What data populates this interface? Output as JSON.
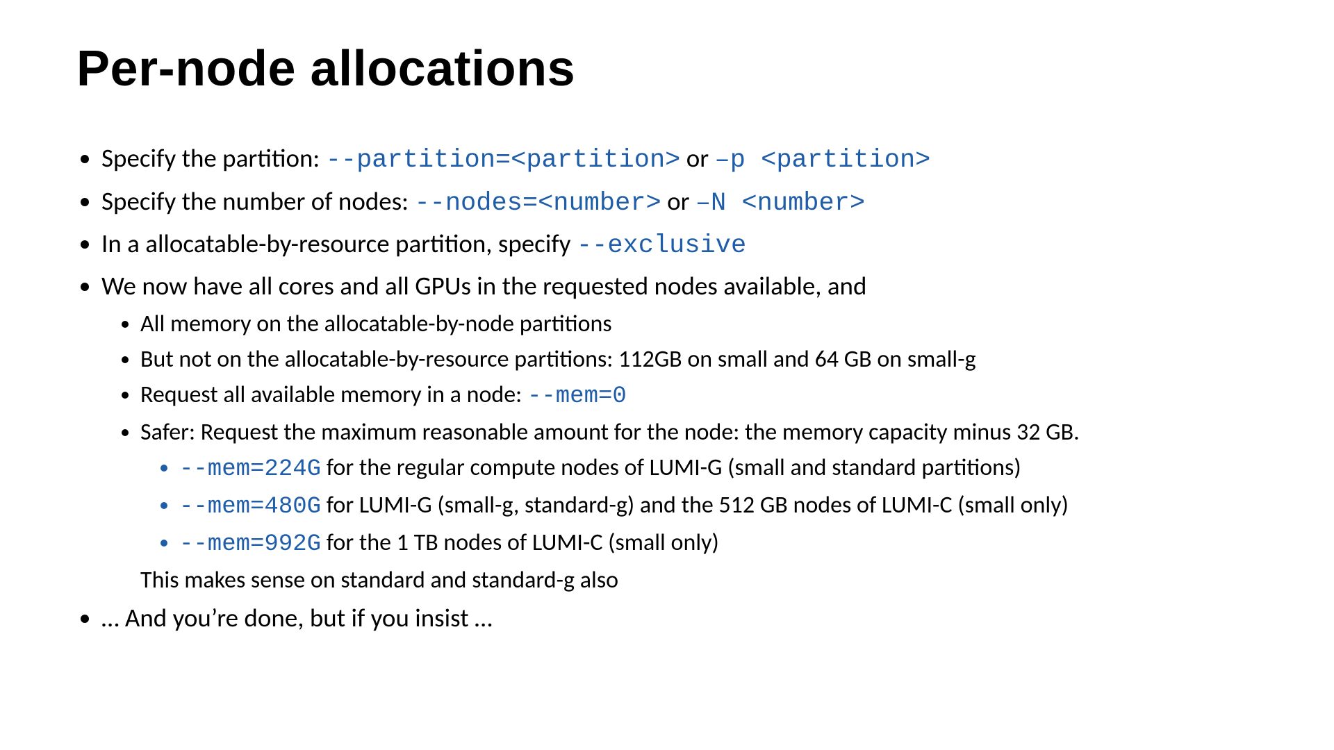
{
  "title": "Per-node allocations",
  "b1_pre": "Specify the partition: ",
  "b1_c1": "--partition=<partition>",
  "b1_mid": " or ",
  "b1_c2": "–p <partition>",
  "b2_pre": "Specify the number of nodes: ",
  "b2_c1": "--nodes=<number>",
  "b2_mid": " or ",
  "b2_c2": "–N <number>",
  "b3_pre": "In a allocatable-by-resource partition, specify ",
  "b3_c1": "--exclusive",
  "b4": "We now have all cores and all GPUs in the requested nodes available, and",
  "b4_1": "All memory on the allocatable-by-node partitions",
  "b4_2": "But not on the allocatable-by-resource partitions: 112GB on small and 64 GB on small-g",
  "b4_3_pre": "Request all available memory in a node: ",
  "b4_3_c": "--mem=0",
  "b4_4": "Safer: Request the maximum reasonable amount for the node: the memory capacity minus 32 GB.",
  "b4_4_1_c": "--mem=224G",
  "b4_4_1_t": " for the regular compute nodes of LUMI-G (small and standard partitions)",
  "b4_4_2_c": "--mem=480G",
  "b4_4_2_t": " for LUMI-G (small-g, standard-g) and the 512 GB nodes of LUMI-C (small only)",
  "b4_4_3_c": "--mem=992G",
  "b4_4_3_t": " for the 1 TB nodes of LUMI-C (small only)",
  "b4_4_after": "This makes sense on standard and standard-g also",
  "b5": "… And you’re done, but if you insist …"
}
